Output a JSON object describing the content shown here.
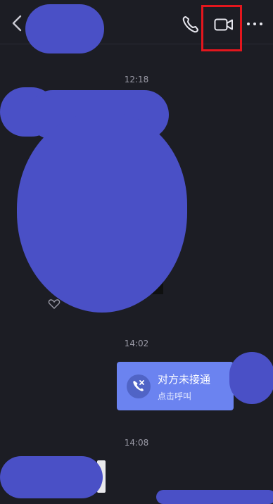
{
  "header": {
    "back_icon": "chevron-left-icon",
    "voice_call_icon": "phone-icon",
    "video_call_icon": "video-camera-icon",
    "more_icon": "more-horizontal-icon",
    "highlight_color": "#e3161d"
  },
  "messages": {
    "time_1": "12:18",
    "time_2": "14:02",
    "time_3": "14:08",
    "call_record": {
      "title": "对方未接通",
      "subtitle": "点击呼叫",
      "icon": "missed-call-icon"
    }
  },
  "colors": {
    "background": "#1c1d24",
    "redaction": "#4a50c6",
    "call_bubble": "#6b83f0"
  }
}
